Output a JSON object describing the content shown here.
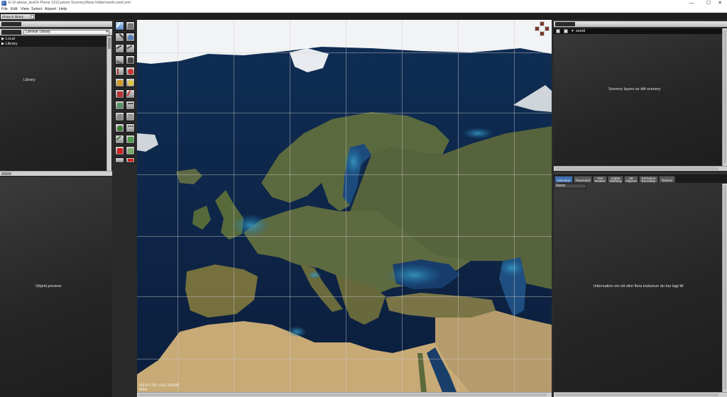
{
  "window": {
    "title": "E:\\X-plane_test\\X-Plane 11\\Custom Scenery\\New folder\\earth.wed.xml",
    "minimize_glyph": "—",
    "maximize_glyph": "☐",
    "close_glyph": "✕"
  },
  "menu": [
    "File",
    "Edit",
    "View",
    "Select",
    "Airport",
    "Help"
  ],
  "left_panel": {
    "header_field": "Show in library",
    "library_filter": "Laminar Library",
    "tree": [
      {
        "arrow": "▶",
        "label": "Local"
      },
      {
        "arrow": "▶",
        "label": "Library"
      }
    ],
    "library_label": "Library",
    "preview_label": "Objekt preview"
  },
  "map": {
    "coords": "+69.671781  +013.236980",
    "scale": "300m",
    "colors": {
      "ocean": "#102a4c",
      "land": "#56613b",
      "desert": "#c9ab77",
      "ice": "#e9ecef"
    }
  },
  "right_panel": {
    "layer_root": "world",
    "layers_label": "Scenery layers av ditt scenery",
    "tabs": [
      {
        "label": "Selection",
        "active": true
      },
      {
        "label": "Pavement",
        "active": false
      },
      {
        "label": "Taxi Routes",
        "active": false
      },
      {
        "label": "Lights Marking",
        "active": false
      },
      {
        "label": "3D Objects",
        "active": false
      },
      {
        "label": "Exclusion Boundary",
        "active": false
      },
      {
        "label": "Texture",
        "active": false
      }
    ],
    "name_header": "Name",
    "info_label": "Information om ett eller flera instancer du har lagt till"
  }
}
